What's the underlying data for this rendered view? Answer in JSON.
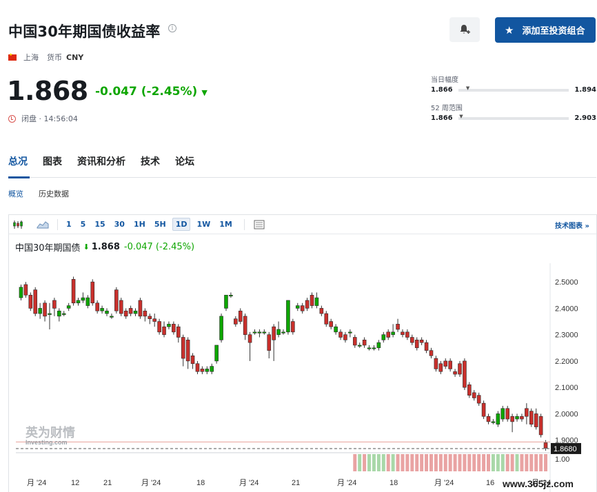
{
  "header": {
    "title": "中国30年期国债收益率",
    "region": "上海",
    "currency_label": "货币",
    "currency_code": "CNY",
    "add_button_label": "添加至投资组合"
  },
  "quote": {
    "price": "1.868",
    "change": "-0.047 (-2.45%)",
    "status": "闭盘 · 14:56:04"
  },
  "ranges": [
    {
      "label": "当日幅度",
      "low": "1.866",
      "high": "1.894",
      "position": 0.07
    },
    {
      "label": "52 周范围",
      "low": "1.866",
      "high": "2.903",
      "position": 0.01
    }
  ],
  "tabs": [
    "总况",
    "图表",
    "资讯和分析",
    "技术",
    "论坛"
  ],
  "subtabs": [
    "概览",
    "历史数据"
  ],
  "toolbar": {
    "intervals": [
      "1",
      "5",
      "15",
      "30",
      "1H",
      "5H",
      "1D",
      "1W",
      "1M"
    ],
    "selected_interval": "1D",
    "tech_chart_label": "技术图表 »"
  },
  "legend": {
    "name": "中国30年期国债",
    "value": "1.868",
    "change": "-0.047 (-2.45%)"
  },
  "watermark": {
    "brand": "英为财情",
    "sub": "Investing.com"
  },
  "site_watermark": "www.365jz.com",
  "colors": {
    "up": "#0ea600",
    "down": "#c9302c",
    "accent": "#1256a0",
    "last_price_line": "#e8a09a"
  },
  "chart_data": {
    "type": "candlestick",
    "y_ticks": [
      "2.5000",
      "2.4000",
      "2.3000",
      "2.2000",
      "2.1000",
      "2.0000",
      "1.9000"
    ],
    "y_range": [
      1.86,
      2.55
    ],
    "last_price_label": "1.8680",
    "volume_tick": "1.00",
    "x_ticks": [
      "月 '24",
      "12",
      "21",
      "月 '24",
      "18",
      "月 '24",
      "21",
      "月 '24",
      "18",
      "月 '24",
      "16",
      "月 '24"
    ],
    "series": [
      {
        "candles": [
          [
            2.44,
            2.48,
            2.49,
            2.43
          ],
          [
            2.49,
            2.45,
            2.5,
            2.44
          ],
          [
            2.45,
            2.4,
            2.46,
            2.39
          ],
          [
            2.47,
            2.38,
            2.48,
            2.37
          ],
          [
            2.38,
            2.4,
            2.42,
            2.36
          ],
          [
            2.42,
            2.37,
            2.43,
            2.35
          ],
          [
            2.38,
            2.38,
            2.42,
            2.32
          ],
          [
            2.43,
            2.4,
            2.44,
            2.37
          ],
          [
            2.37,
            2.39,
            2.4,
            2.35
          ],
          [
            2.38,
            2.38,
            2.39,
            2.37
          ],
          [
            2.4,
            2.41,
            2.42,
            2.39
          ],
          [
            2.51,
            2.42,
            2.52,
            2.41
          ],
          [
            2.42,
            2.43,
            2.44,
            2.41
          ],
          [
            2.43,
            2.44,
            2.46,
            2.42
          ],
          [
            2.41,
            2.44,
            2.45,
            2.4
          ],
          [
            2.5,
            2.42,
            2.51,
            2.41
          ],
          [
            2.42,
            2.39,
            2.43,
            2.38
          ],
          [
            2.39,
            2.4,
            2.41,
            2.38
          ],
          [
            2.38,
            2.39,
            2.4,
            2.37
          ],
          [
            2.37,
            2.37,
            2.38,
            2.36
          ],
          [
            2.47,
            2.39,
            2.48,
            2.38
          ],
          [
            2.43,
            2.38,
            2.44,
            2.37
          ],
          [
            2.39,
            2.37,
            2.4,
            2.36
          ],
          [
            2.4,
            2.38,
            2.41,
            2.37
          ],
          [
            2.38,
            2.39,
            2.4,
            2.37
          ],
          [
            2.43,
            2.37,
            2.44,
            2.36
          ],
          [
            2.39,
            2.37,
            2.4,
            2.35
          ],
          [
            2.37,
            2.36,
            2.38,
            2.34
          ],
          [
            2.36,
            2.35,
            2.38,
            2.33
          ],
          [
            2.35,
            2.31,
            2.36,
            2.3
          ],
          [
            2.33,
            2.3,
            2.35,
            2.29
          ],
          [
            2.33,
            2.34,
            2.35,
            2.32
          ],
          [
            2.34,
            2.31,
            2.35,
            2.3
          ],
          [
            2.33,
            2.29,
            2.34,
            2.27
          ],
          [
            2.29,
            2.21,
            2.3,
            2.18
          ],
          [
            2.28,
            2.2,
            2.29,
            2.17
          ],
          [
            2.22,
            2.19,
            2.23,
            2.17
          ],
          [
            2.19,
            2.16,
            2.2,
            2.15
          ],
          [
            2.17,
            2.16,
            2.18,
            2.15
          ],
          [
            2.16,
            2.17,
            2.18,
            2.15
          ],
          [
            2.16,
            2.18,
            2.19,
            2.15
          ],
          [
            2.2,
            2.26,
            2.26,
            2.19
          ],
          [
            2.28,
            2.37,
            2.38,
            2.27
          ],
          [
            2.4,
            2.45,
            2.45,
            2.39
          ],
          [
            2.45,
            2.45,
            2.46,
            2.44
          ],
          [
            2.36,
            2.34,
            2.37,
            2.33
          ],
          [
            2.39,
            2.35,
            2.4,
            2.34
          ],
          [
            2.37,
            2.3,
            2.38,
            2.28
          ],
          [
            2.3,
            2.27,
            2.31,
            2.2
          ],
          [
            2.31,
            2.31,
            2.32,
            2.3
          ],
          [
            2.31,
            2.31,
            2.32,
            2.29
          ],
          [
            2.31,
            2.31,
            2.32,
            2.3
          ],
          [
            2.3,
            2.24,
            2.31,
            2.21
          ],
          [
            2.33,
            2.28,
            2.34,
            2.2
          ],
          [
            2.3,
            2.32,
            2.35,
            2.29
          ],
          [
            2.31,
            2.31,
            2.32,
            2.3
          ],
          [
            2.31,
            2.43,
            2.43,
            2.3
          ],
          [
            2.35,
            2.31,
            2.36,
            2.3
          ],
          [
            2.4,
            2.41,
            2.42,
            2.39
          ],
          [
            2.41,
            2.39,
            2.42,
            2.38
          ],
          [
            2.43,
            2.4,
            2.44,
            2.39
          ],
          [
            2.45,
            2.41,
            2.46,
            2.4
          ],
          [
            2.41,
            2.44,
            2.46,
            2.4
          ],
          [
            2.4,
            2.38,
            2.41,
            2.37
          ],
          [
            2.38,
            2.34,
            2.39,
            2.33
          ],
          [
            2.35,
            2.33,
            2.36,
            2.32
          ],
          [
            2.31,
            2.33,
            2.34,
            2.3
          ],
          [
            2.31,
            2.29,
            2.32,
            2.28
          ],
          [
            2.3,
            2.28,
            2.31,
            2.27
          ],
          [
            2.31,
            2.31,
            2.32,
            2.29
          ],
          [
            2.29,
            2.26,
            2.3,
            2.25
          ],
          [
            2.26,
            2.26,
            2.27,
            2.25
          ],
          [
            2.28,
            2.26,
            2.29,
            2.25
          ],
          [
            2.25,
            2.25,
            2.26,
            2.24
          ],
          [
            2.25,
            2.25,
            2.26,
            2.24
          ],
          [
            2.25,
            2.27,
            2.28,
            2.24
          ],
          [
            2.28,
            2.3,
            2.31,
            2.27
          ],
          [
            2.31,
            2.29,
            2.32,
            2.28
          ],
          [
            2.3,
            2.31,
            2.34,
            2.29
          ],
          [
            2.34,
            2.32,
            2.36,
            2.31
          ],
          [
            2.31,
            2.3,
            2.32,
            2.29
          ],
          [
            2.31,
            2.29,
            2.32,
            2.28
          ],
          [
            2.29,
            2.27,
            2.3,
            2.26
          ],
          [
            2.28,
            2.25,
            2.29,
            2.24
          ],
          [
            2.28,
            2.27,
            2.29,
            2.26
          ],
          [
            2.27,
            2.24,
            2.28,
            2.23
          ],
          [
            2.24,
            2.22,
            2.25,
            2.21
          ],
          [
            2.21,
            2.17,
            2.22,
            2.16
          ],
          [
            2.19,
            2.16,
            2.2,
            2.15
          ],
          [
            2.2,
            2.18,
            2.21,
            2.17
          ],
          [
            2.2,
            2.17,
            2.21,
            2.16
          ],
          [
            2.16,
            2.15,
            2.17,
            2.14
          ],
          [
            2.19,
            2.15,
            2.2,
            2.14
          ],
          [
            2.2,
            2.1,
            2.21,
            2.09
          ],
          [
            2.11,
            2.07,
            2.12,
            2.06
          ],
          [
            2.08,
            2.06,
            2.09,
            2.05
          ],
          [
            2.07,
            2.04,
            2.08,
            2.03
          ],
          [
            2.04,
            1.99,
            2.05,
            1.98
          ],
          [
            1.99,
            1.97,
            2.0,
            1.96
          ],
          [
            1.97,
            1.97,
            1.98,
            1.96
          ],
          [
            1.96,
            2.0,
            2.01,
            1.95
          ],
          [
            1.98,
            2.02,
            2.03,
            1.97
          ],
          [
            2.02,
            1.98,
            2.03,
            1.97
          ],
          [
            1.99,
            1.97,
            2.0,
            1.93
          ],
          [
            1.98,
            1.99,
            2.0,
            1.97
          ],
          [
            1.99,
            1.98,
            2.0,
            1.97
          ],
          [
            2.02,
            1.99,
            2.04,
            1.96
          ],
          [
            2.01,
            1.96,
            2.02,
            1.95
          ],
          [
            2.0,
            1.95,
            2.02,
            1.94
          ],
          [
            1.99,
            1.92,
            2.0,
            1.91
          ],
          [
            1.89,
            1.87,
            1.9,
            1.86
          ]
        ]
      }
    ]
  }
}
